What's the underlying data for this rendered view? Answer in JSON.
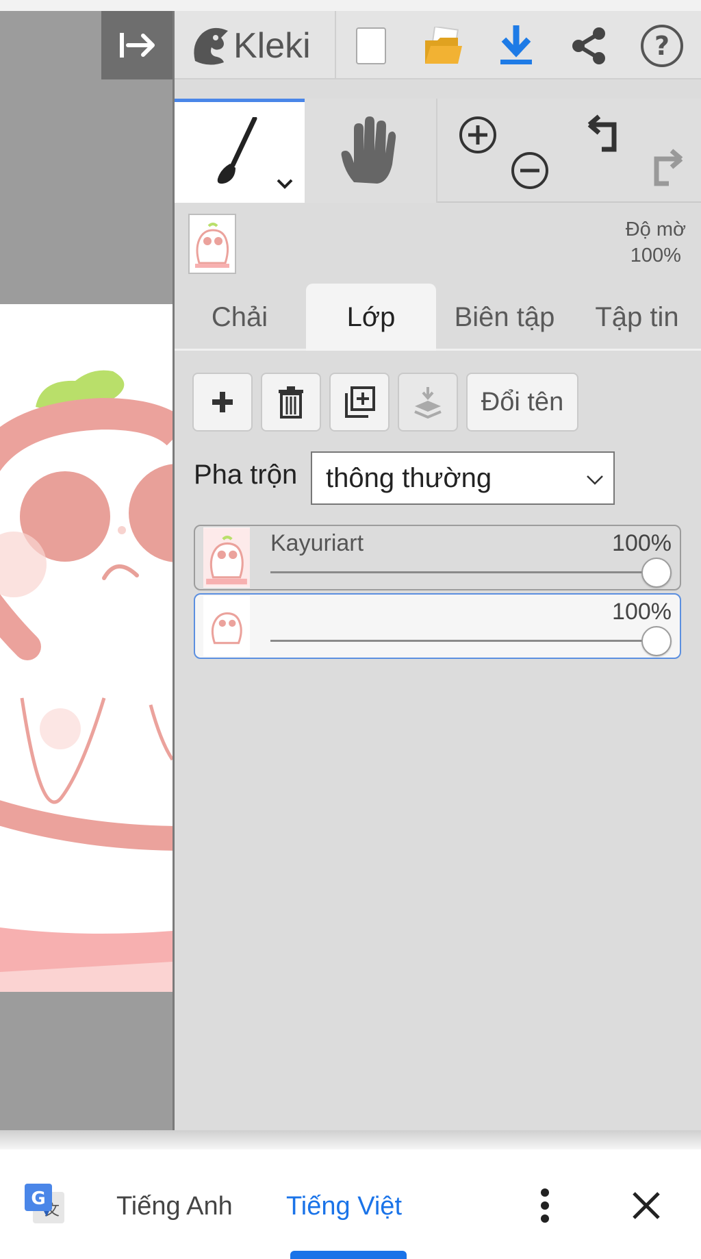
{
  "app": {
    "logo_text": "Kleki"
  },
  "toolbar_icons": [
    "collapse-panel-icon",
    "kleki-logo-icon",
    "new-file-icon",
    "open-folder-icon",
    "download-icon",
    "share-icon",
    "help-icon"
  ],
  "tools": {
    "brush": "brush-icon",
    "hand": "hand-icon",
    "zoom_in": "zoom-in-icon",
    "zoom_out": "zoom-out-icon",
    "undo": "undo-icon",
    "redo": "redo-icon"
  },
  "layer_opacity": {
    "label": "Độ mờ",
    "value": "100%"
  },
  "tabs": [
    {
      "label": "Chải",
      "active": false
    },
    {
      "label": "Lớp",
      "active": true
    },
    {
      "label": "Biên tập",
      "active": false
    },
    {
      "label": "Tập tin",
      "active": false
    }
  ],
  "layer_buttons": {
    "rename_label": "Đổi tên"
  },
  "blend": {
    "label": "Pha trộn",
    "value": "thông thường"
  },
  "layers": [
    {
      "name": "Kayuriart",
      "opacity": "100%",
      "opacity_value": 1.0,
      "selected": false
    },
    {
      "name": "",
      "opacity": "100%",
      "opacity_value": 1.0,
      "selected": true
    }
  ],
  "translate_bar": {
    "source_lang": "Tiếng Anh",
    "target_lang": "Tiếng Việt"
  },
  "colors": {
    "accent": "#1a73e8",
    "tab_indicator": "#4a86e8",
    "download_icon": "#1e7be6",
    "folder_icon": "#f2b233",
    "canvas_bg": "#9c9c9c",
    "panel_bg": "#dcdcdc",
    "drawing_pink": "#eba29c",
    "drawing_leaf": "#b9df6a"
  }
}
